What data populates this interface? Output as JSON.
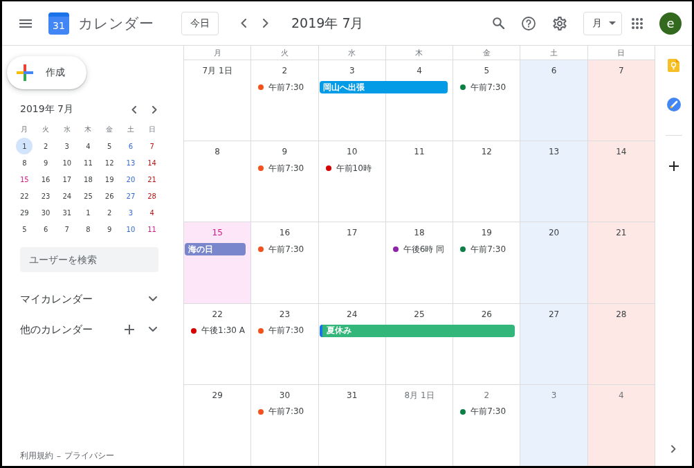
{
  "header": {
    "logo_day": "31",
    "app_name": "カレンダー",
    "today_button": "今日",
    "title": "2019年 7月",
    "view_selector": "月",
    "avatar_letter": "e"
  },
  "sidebar": {
    "create_button": "作成",
    "mini_calendar": {
      "title": "2019年 7月",
      "weekdays": [
        "月",
        "火",
        "水",
        "木",
        "金",
        "土",
        "日"
      ],
      "weeks": [
        {
          "days": [
            {
              "label": "1",
              "kind": "day",
              "selected": true
            },
            {
              "label": "2",
              "kind": "day",
              "selected": false
            },
            {
              "label": "3",
              "kind": "day",
              "selected": false
            },
            {
              "label": "4",
              "kind": "day",
              "selected": false
            },
            {
              "label": "5",
              "kind": "day",
              "selected": false
            },
            {
              "label": "6",
              "kind": "saturday",
              "selected": false
            },
            {
              "label": "7",
              "kind": "sunday",
              "selected": false
            }
          ]
        },
        {
          "days": [
            {
              "label": "8",
              "kind": "day",
              "selected": false
            },
            {
              "label": "9",
              "kind": "day",
              "selected": false
            },
            {
              "label": "10",
              "kind": "day",
              "selected": false
            },
            {
              "label": "11",
              "kind": "day",
              "selected": false
            },
            {
              "label": "12",
              "kind": "day",
              "selected": false
            },
            {
              "label": "13",
              "kind": "saturday",
              "selected": false
            },
            {
              "label": "14",
              "kind": "sunday",
              "selected": false
            }
          ]
        },
        {
          "days": [
            {
              "label": "15",
              "kind": "holiday",
              "selected": false
            },
            {
              "label": "16",
              "kind": "day",
              "selected": false
            },
            {
              "label": "17",
              "kind": "day",
              "selected": false
            },
            {
              "label": "18",
              "kind": "day",
              "selected": false
            },
            {
              "label": "19",
              "kind": "day",
              "selected": false
            },
            {
              "label": "20",
              "kind": "saturday",
              "selected": false
            },
            {
              "label": "21",
              "kind": "sunday",
              "selected": false
            }
          ]
        },
        {
          "days": [
            {
              "label": "22",
              "kind": "day",
              "selected": false
            },
            {
              "label": "23",
              "kind": "day",
              "selected": false
            },
            {
              "label": "24",
              "kind": "day",
              "selected": false
            },
            {
              "label": "25",
              "kind": "day",
              "selected": false
            },
            {
              "label": "26",
              "kind": "day",
              "selected": false
            },
            {
              "label": "27",
              "kind": "saturday",
              "selected": false
            },
            {
              "label": "28",
              "kind": "sunday",
              "selected": false
            }
          ]
        },
        {
          "days": [
            {
              "label": "29",
              "kind": "day",
              "selected": false
            },
            {
              "label": "30",
              "kind": "day",
              "selected": false
            },
            {
              "label": "31",
              "kind": "day",
              "selected": false
            },
            {
              "label": "1",
              "kind": "day",
              "selected": false
            },
            {
              "label": "2",
              "kind": "day",
              "selected": false
            },
            {
              "label": "3",
              "kind": "saturday",
              "selected": false
            },
            {
              "label": "4",
              "kind": "sunday",
              "selected": false
            }
          ]
        },
        {
          "days": [
            {
              "label": "5",
              "kind": "day",
              "selected": false
            },
            {
              "label": "6",
              "kind": "day",
              "selected": false
            },
            {
              "label": "7",
              "kind": "day",
              "selected": false
            },
            {
              "label": "8",
              "kind": "day",
              "selected": false
            },
            {
              "label": "9",
              "kind": "day",
              "selected": false
            },
            {
              "label": "10",
              "kind": "saturday",
              "selected": false
            },
            {
              "label": "11",
              "kind": "holiday",
              "selected": false
            }
          ]
        }
      ]
    },
    "search": {
      "placeholder": "ユーザーを検索"
    },
    "sections": [
      {
        "label": "マイカレンダー",
        "can_add": false,
        "expanded": false
      },
      {
        "label": "他のカレンダー",
        "can_add": true,
        "expanded": false
      }
    ],
    "footer": {
      "links": [
        "利用規約",
        "プライバシー"
      ],
      "separator": "–"
    }
  },
  "calendar": {
    "weekdays": [
      "月",
      "火",
      "水",
      "木",
      "金",
      "土",
      "日"
    ],
    "weeks": [
      {
        "days": [
          {
            "label": "7月 1日",
            "kind": "weekday",
            "other_month": false
          },
          {
            "label": "2",
            "kind": "weekday",
            "other_month": false,
            "events": [
              {
                "text": "午前7:30",
                "color": "#f4511e"
              }
            ]
          },
          {
            "label": "3",
            "kind": "weekday",
            "other_month": false
          },
          {
            "label": "4",
            "kind": "weekday",
            "other_month": false
          },
          {
            "label": "5",
            "kind": "weekday",
            "other_month": false,
            "events": [
              {
                "text": "午前7:30",
                "color": "#0b8043"
              }
            ]
          },
          {
            "label": "6",
            "kind": "saturday",
            "other_month": false
          },
          {
            "label": "7",
            "kind": "sunday",
            "other_month": false
          }
        ],
        "bars": [
          {
            "title": "岡山へ出張",
            "color": "#039be5",
            "selected": false,
            "days_covered": [
              false,
              false,
              true,
              true,
              false,
              false,
              false
            ]
          }
        ]
      },
      {
        "days": [
          {
            "label": "8",
            "kind": "weekday",
            "other_month": false
          },
          {
            "label": "9",
            "kind": "weekday",
            "other_month": false,
            "events": [
              {
                "text": "午前7:30",
                "color": "#f4511e"
              }
            ]
          },
          {
            "label": "10",
            "kind": "weekday",
            "other_month": false,
            "events": [
              {
                "text": "午前10時",
                "color": "#d50000"
              }
            ]
          },
          {
            "label": "11",
            "kind": "weekday",
            "other_month": false
          },
          {
            "label": "12",
            "kind": "weekday",
            "other_month": false
          },
          {
            "label": "13",
            "kind": "saturday",
            "other_month": false
          },
          {
            "label": "14",
            "kind": "sunday",
            "other_month": false
          }
        ]
      },
      {
        "days": [
          {
            "label": "15",
            "kind": "holiday",
            "other_month": false
          },
          {
            "label": "16",
            "kind": "weekday",
            "other_month": false,
            "events": [
              {
                "text": "午前7:30",
                "color": "#f4511e"
              }
            ]
          },
          {
            "label": "17",
            "kind": "weekday",
            "other_month": false
          },
          {
            "label": "18",
            "kind": "weekday",
            "other_month": false,
            "events": [
              {
                "text": "午後6時 同",
                "color": "#8e24aa"
              }
            ]
          },
          {
            "label": "19",
            "kind": "weekday",
            "other_month": false,
            "events": [
              {
                "text": "午前7:30",
                "color": "#0b8043"
              }
            ]
          },
          {
            "label": "20",
            "kind": "saturday",
            "other_month": false
          },
          {
            "label": "21",
            "kind": "sunday",
            "other_month": false
          }
        ],
        "bars": [
          {
            "title": "海の日",
            "color": "#7986cb",
            "selected": false,
            "days_covered": [
              true,
              false,
              false,
              false,
              false,
              false,
              false
            ]
          }
        ]
      },
      {
        "days": [
          {
            "label": "22",
            "kind": "weekday",
            "other_month": false,
            "events": [
              {
                "text": "午後1:30 A",
                "color": "#d50000"
              }
            ]
          },
          {
            "label": "23",
            "kind": "weekday",
            "other_month": false,
            "events": [
              {
                "text": "午前7:30",
                "color": "#f4511e"
              }
            ]
          },
          {
            "label": "24",
            "kind": "weekday",
            "other_month": false
          },
          {
            "label": "25",
            "kind": "weekday",
            "other_month": false
          },
          {
            "label": "26",
            "kind": "weekday",
            "other_month": false
          },
          {
            "label": "27",
            "kind": "saturday",
            "other_month": false
          },
          {
            "label": "28",
            "kind": "sunday",
            "other_month": false
          }
        ],
        "bars": [
          {
            "title": "夏休み",
            "color": "#33b679",
            "selected": true,
            "days_covered": [
              false,
              false,
              true,
              true,
              true,
              false,
              false
            ]
          }
        ]
      },
      {
        "days": [
          {
            "label": "29",
            "kind": "weekday",
            "other_month": false
          },
          {
            "label": "30",
            "kind": "weekday",
            "other_month": false,
            "events": [
              {
                "text": "午前7:30",
                "color": "#f4511e"
              }
            ]
          },
          {
            "label": "31",
            "kind": "weekday",
            "other_month": false
          },
          {
            "label": "8月 1日",
            "kind": "weekday",
            "other_month": true
          },
          {
            "label": "2",
            "kind": "weekday",
            "other_month": true,
            "events": [
              {
                "text": "午前7:30",
                "color": "#0b8043"
              }
            ]
          },
          {
            "label": "3",
            "kind": "saturday",
            "other_month": true
          },
          {
            "label": "4",
            "kind": "sunday",
            "other_month": true
          }
        ]
      }
    ]
  }
}
